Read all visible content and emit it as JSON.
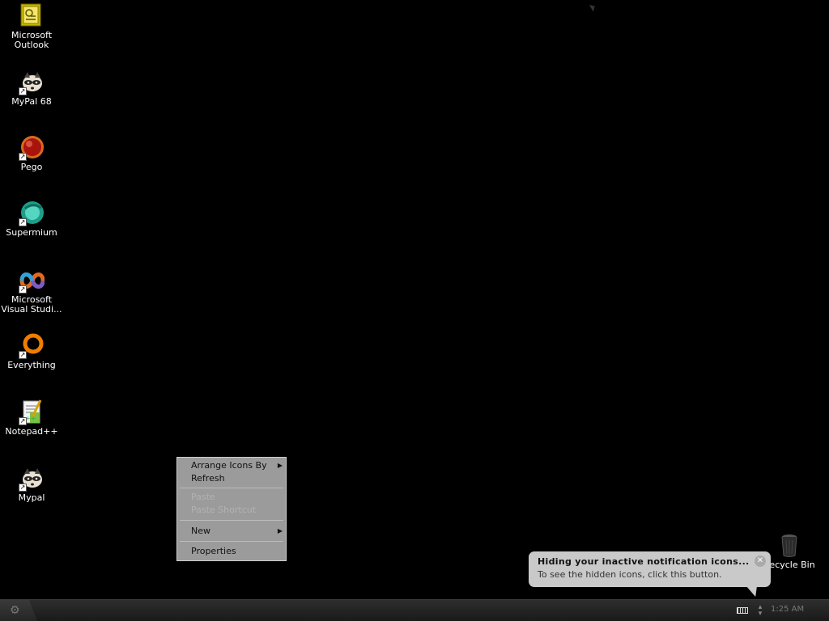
{
  "desktop_icons": [
    {
      "label": "Microsoft\nOutlook",
      "icon": "outlook-icon",
      "shortcut": false
    },
    {
      "label": "MyPal 68",
      "icon": "mypal-raccoon-icon",
      "shortcut": true
    },
    {
      "label": "Pego",
      "icon": "pego-icon",
      "shortcut": true
    },
    {
      "label": "Supermium",
      "icon": "supermium-icon",
      "shortcut": true
    },
    {
      "label": "Microsoft\nVisual Studi...",
      "icon": "visual-studio-icon",
      "shortcut": true
    },
    {
      "label": "Everything",
      "icon": "everything-search-icon",
      "shortcut": true
    },
    {
      "label": "Notepad++",
      "icon": "notepad-plus-plus-icon",
      "shortcut": true
    },
    {
      "label": "Mypal",
      "icon": "mypal-raccoon-icon",
      "shortcut": true
    },
    {
      "label": "Recycle Bin",
      "icon": "recycle-bin-icon",
      "shortcut": false
    }
  ],
  "context_menu": {
    "items": [
      {
        "label": "Arrange Icons By",
        "submenu": true,
        "enabled": true
      },
      {
        "label": "Refresh",
        "submenu": false,
        "enabled": true
      },
      {
        "label": "Paste",
        "submenu": false,
        "enabled": false
      },
      {
        "label": "Paste Shortcut",
        "submenu": false,
        "enabled": false
      },
      {
        "label": "New",
        "submenu": true,
        "enabled": true
      },
      {
        "label": "Properties",
        "submenu": false,
        "enabled": true
      }
    ]
  },
  "balloon": {
    "title": "Hiding your inactive notification icons...",
    "body": "To see the hidden icons, click this button.",
    "close_symbol": "✕"
  },
  "taskbar": {
    "clock": "1:25 AM"
  },
  "colors": {
    "desktop_background": "#000000",
    "menu_background": "#9b9b9b",
    "balloon_background": "#c9c9c9",
    "taskbar": "#242424"
  }
}
